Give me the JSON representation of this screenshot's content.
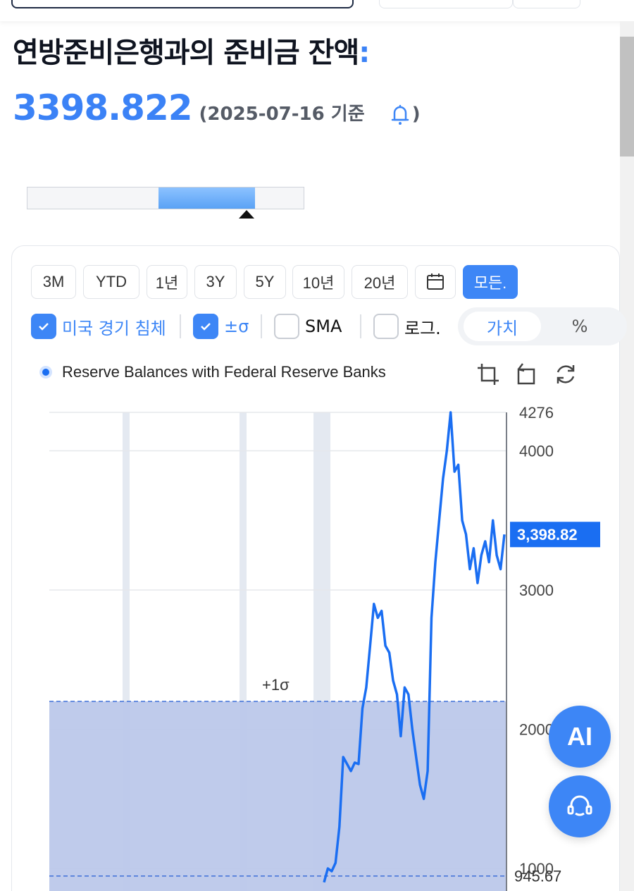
{
  "page": {
    "title": "연방준비은행과의 준비금 잔액",
    "title_colon": ":",
    "value": "3398.822",
    "as_of": "(2025-07-16 기준",
    "as_of_close": ")"
  },
  "periods": [
    "3M",
    "YTD",
    "1년",
    "3Y",
    "5Y",
    "10년",
    "20년",
    "calendar",
    "모든."
  ],
  "options": {
    "recession": {
      "label": "미국 경기 침체",
      "checked": true
    },
    "sigma": {
      "label": "±σ",
      "checked": true
    },
    "sma": {
      "label": "SMA",
      "checked": false
    },
    "log": {
      "label": "로그.",
      "checked": false
    }
  },
  "toggle": {
    "value_label": "가치",
    "percent_label": "%"
  },
  "legend": {
    "series_name": "Reserve Balances with Federal Reserve Banks"
  },
  "fab": {
    "ai_label": "AI"
  },
  "colors": {
    "accent": "#3d86f6",
    "line": "#1a6ef2",
    "band": "#bcc8ea"
  },
  "chart_data": {
    "type": "line",
    "series": [
      {
        "name": "Reserve Balances with Federal Reserve Banks",
        "values": [
          900,
          1000,
          980,
          1040,
          1300,
          1800,
          1750,
          1700,
          1760,
          1750,
          2150,
          2300,
          2600,
          2900,
          2800,
          2850,
          2600,
          2550,
          2350,
          2250,
          1950,
          2300,
          2250,
          2000,
          1800,
          1600,
          1500,
          1700,
          2800,
          3200,
          3500,
          3800,
          4000,
          4276,
          3850,
          3900,
          3500,
          3400,
          3150,
          3300,
          3050,
          3250,
          3350,
          3200,
          3500,
          3250,
          3150,
          3398.82
        ]
      }
    ],
    "y_ticks": [
      "4276",
      "4000",
      "3000",
      "2000",
      "1000"
    ],
    "current_label": "3,398.82",
    "sigma_upper_label": "+1σ",
    "sigma_lower_value": "945.67",
    "ylim": [
      600,
      4276
    ]
  }
}
